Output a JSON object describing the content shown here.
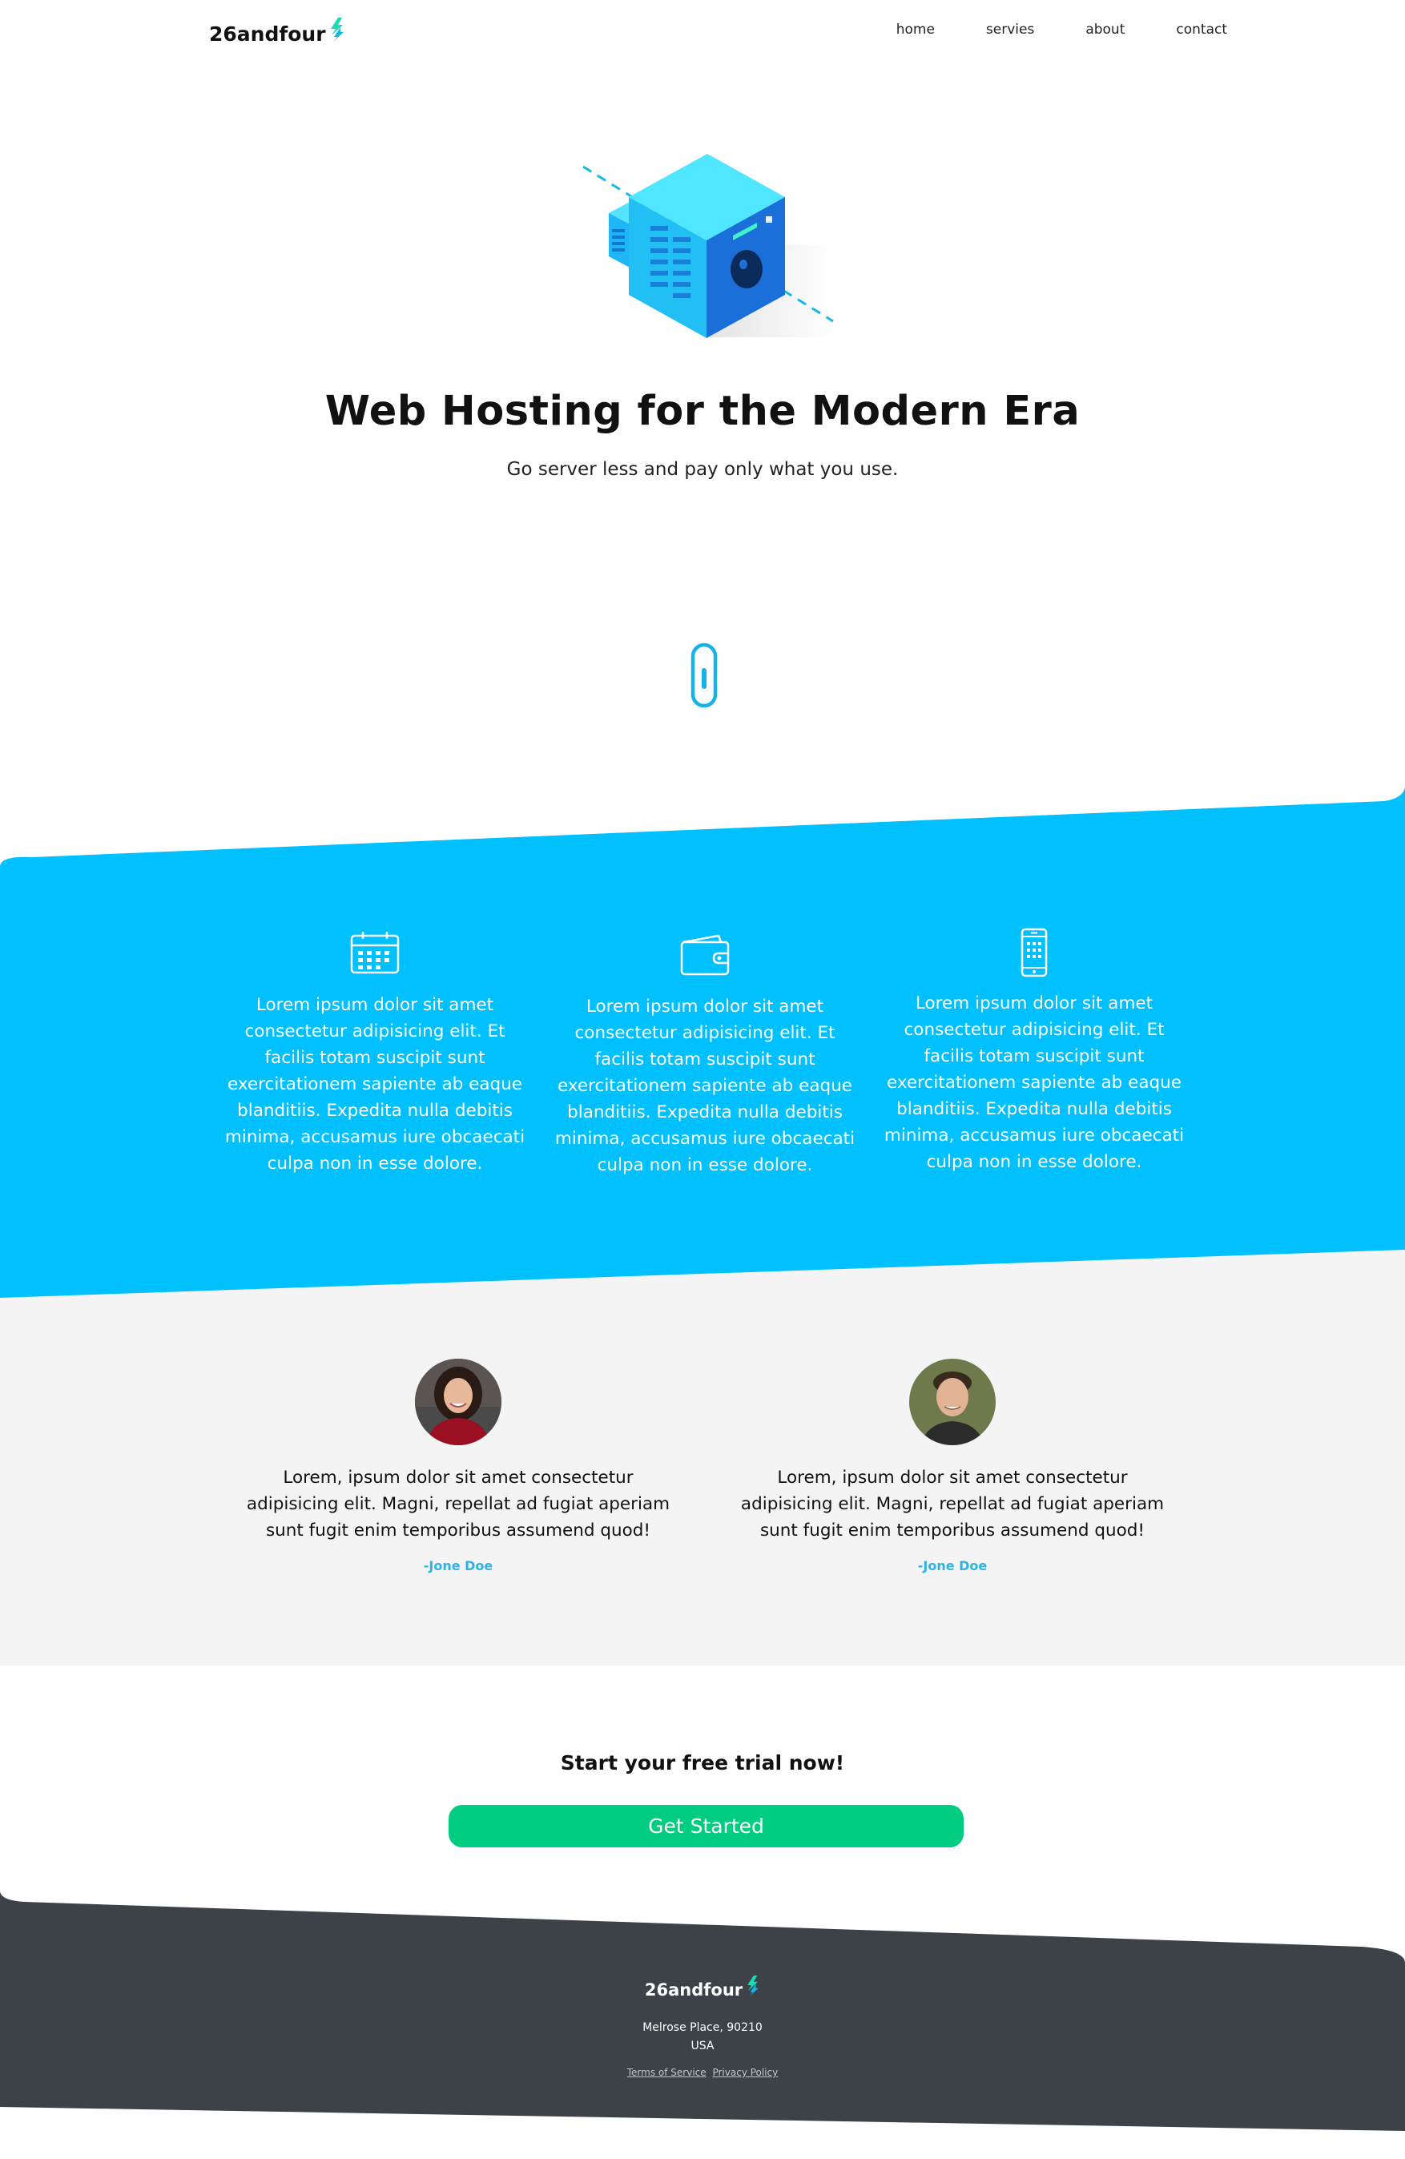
{
  "header": {
    "logo_text": "26andfour",
    "nav": [
      {
        "label": "home"
      },
      {
        "label": "servies"
      },
      {
        "label": "about"
      },
      {
        "label": "contact"
      }
    ]
  },
  "hero": {
    "title": "Web Hosting for the Modern Era",
    "subtitle": "Go server less and pay only what you use."
  },
  "features": [
    {
      "icon": "calendar-icon",
      "text": "Lorem ipsum dolor sit amet consectetur adipisicing elit. Et facilis totam suscipit sunt exercitationem sapiente ab eaque blanditiis. Expedita nulla debitis minima, accusamus iure obcaecati culpa non in esse dolore."
    },
    {
      "icon": "wallet-icon",
      "text": "Lorem ipsum dolor sit amet consectetur adipisicing elit. Et facilis totam suscipit sunt exercitationem sapiente ab eaque blanditiis. Expedita nulla debitis minima, accusamus iure obcaecati culpa non in esse dolore."
    },
    {
      "icon": "smartphone-icon",
      "text": "Lorem ipsum dolor sit amet consectetur adipisicing elit. Et facilis totam suscipit sunt exercitationem sapiente ab eaque blanditiis. Expedita nulla debitis minima, accusamus iure obcaecati culpa non in esse dolore."
    }
  ],
  "testimonials": [
    {
      "quote": "Lorem, ipsum dolor sit amet consectetur adipisicing elit. Magni, repellat ad fugiat aperiam sunt fugit enim temporibus assumend quod!",
      "author": "-Jone Doe"
    },
    {
      "quote": "Lorem, ipsum dolor sit amet consectetur adipisicing elit. Magni, repellat ad fugiat aperiam sunt fugit enim temporibus assumend quod!",
      "author": "-Jone Doe"
    }
  ],
  "cta": {
    "title": "Start your free trial now!",
    "button_label": "Get Started"
  },
  "footer": {
    "logo_text": "26andfour",
    "address_line1": "Melrose Place, 90210",
    "address_line2": "USA",
    "links": [
      {
        "label": "Terms of Service"
      },
      {
        "label": "Privacy Policy"
      }
    ]
  },
  "colors": {
    "accent_blue": "#00c1fd",
    "cta_green": "#00cd7f",
    "footer_dark": "#3d4248",
    "testimonial_bg": "#f4f4f4",
    "author_blue": "#2fb3e3",
    "logo_bolt": "#1ed9b6"
  }
}
